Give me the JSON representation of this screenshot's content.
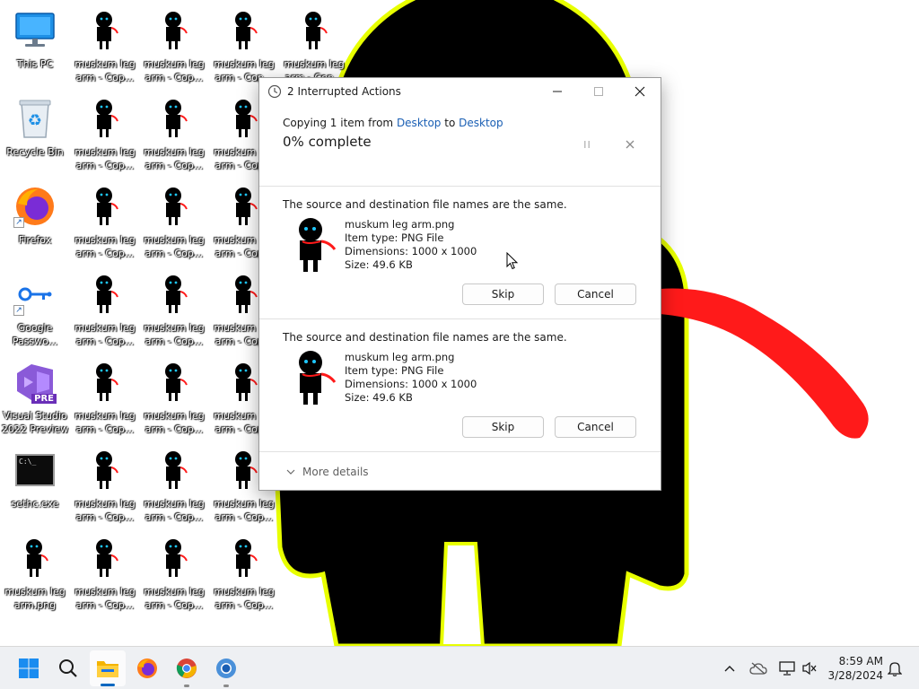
{
  "desktop": {
    "icons": [
      {
        "label": "This PC"
      },
      {
        "label": "Recycle Bin"
      },
      {
        "label": "Firefox"
      },
      {
        "label": "Google Passwo..."
      },
      {
        "label": "Visual Studio 2022 Preview"
      },
      {
        "label": "sethc.exe"
      },
      {
        "label": "muskum leg arm.png"
      },
      {
        "label": "muskum leg arm - Cop..."
      },
      {
        "label": "muskum leg arm - Cop..."
      },
      {
        "label": "muskum leg arm - Cop..."
      },
      {
        "label": "muskum leg arm - Cop..."
      }
    ],
    "badge_pre": "PRE",
    "cmd_prompt": "C:\\_"
  },
  "dialog": {
    "title": "2 Interrupted Actions",
    "copy_prefix": "Copying 1 item from ",
    "copy_source": "Desktop",
    "copy_to": " to ",
    "copy_dest": "Desktop",
    "percent_text": "0% complete",
    "progress": 0,
    "conflicts": [
      {
        "message": "The source and destination file names are the same.",
        "file_name": "muskum leg arm.png",
        "item_type": "Item type: PNG File",
        "dimensions": "Dimensions: 1000 x 1000",
        "size": "Size: 49.6 KB",
        "skip_label": "Skip",
        "cancel_label": "Cancel"
      },
      {
        "message": "The source and destination file names are the same.",
        "file_name": "muskum leg arm.png",
        "item_type": "Item type: PNG File",
        "dimensions": "Dimensions: 1000 x 1000",
        "size": "Size: 49.6 KB",
        "skip_label": "Skip",
        "cancel_label": "Cancel"
      }
    ],
    "more_details": "More details"
  },
  "taskbar": {
    "time": "8:59 AM",
    "date": "3/28/2024"
  },
  "colors": {
    "accent": "#0067c0",
    "link": "#1a5fb4",
    "figure_black": "#000000",
    "figure_outline": "#e8ff00",
    "scarf_red": "#ff1a1a"
  }
}
